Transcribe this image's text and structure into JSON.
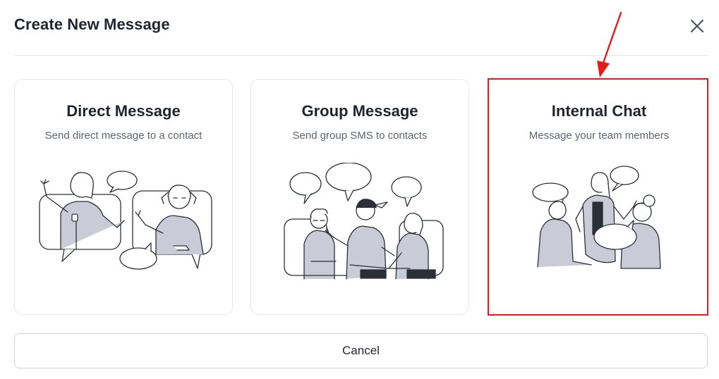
{
  "dialog": {
    "title": "Create New Message",
    "close_icon": "close-icon",
    "cancel_label": "Cancel"
  },
  "options": [
    {
      "id": "direct",
      "title": "Direct Message",
      "description": "Send direct message to a contact",
      "illustration": "two-people-video-call-illustration"
    },
    {
      "id": "group",
      "title": "Group Message",
      "description": "Send group SMS to contacts",
      "illustration": "group-conversation-illustration"
    },
    {
      "id": "internal",
      "title": "Internal Chat",
      "description": "Message your team members",
      "illustration": "team-members-chat-illustration",
      "highlighted": true
    }
  ],
  "annotation": {
    "highlight_color": "#e21b1b",
    "arrow_icon": "red-arrow-icon"
  },
  "colors": {
    "illustration_fill": "#c9ccd6",
    "border": "#e5e7eb"
  }
}
